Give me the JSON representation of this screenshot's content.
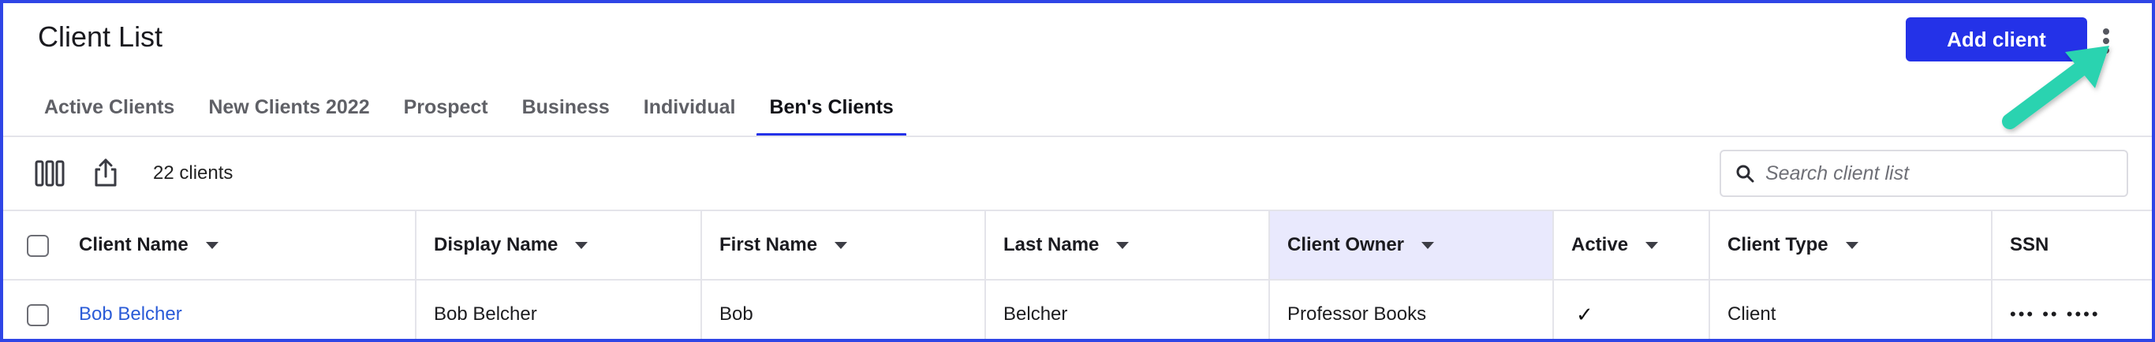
{
  "header": {
    "title": "Client List",
    "add_button_label": "Add client",
    "accent_color": "#2432e8"
  },
  "tabs": [
    {
      "label": "Active Clients",
      "active": false
    },
    {
      "label": "New Clients 2022",
      "active": false
    },
    {
      "label": "Prospect",
      "active": false
    },
    {
      "label": "Business",
      "active": false
    },
    {
      "label": "Individual",
      "active": false
    },
    {
      "label": "Ben's Clients",
      "active": true
    }
  ],
  "toolbar": {
    "count_label": "22 clients",
    "columns_icon": "columns-icon",
    "export_icon": "share-export-icon",
    "search_icon": "search-icon",
    "search_placeholder": "Search client list"
  },
  "table": {
    "columns": [
      {
        "label": "Client Name"
      },
      {
        "label": "Display Name"
      },
      {
        "label": "First Name"
      },
      {
        "label": "Last Name"
      },
      {
        "label": "Client Owner"
      },
      {
        "label": "Active"
      },
      {
        "label": "Client Type"
      },
      {
        "label": "SSN"
      }
    ],
    "rows": [
      {
        "client_name": "Bob Belcher",
        "display_name": "Bob Belcher",
        "first_name": "Bob",
        "last_name": "Belcher",
        "client_owner": "Professor Books",
        "active": "✓",
        "client_type": "Client",
        "ssn": "••• •• ••••"
      }
    ]
  },
  "annotation": {
    "arrow_color": "#2ad3b0"
  }
}
